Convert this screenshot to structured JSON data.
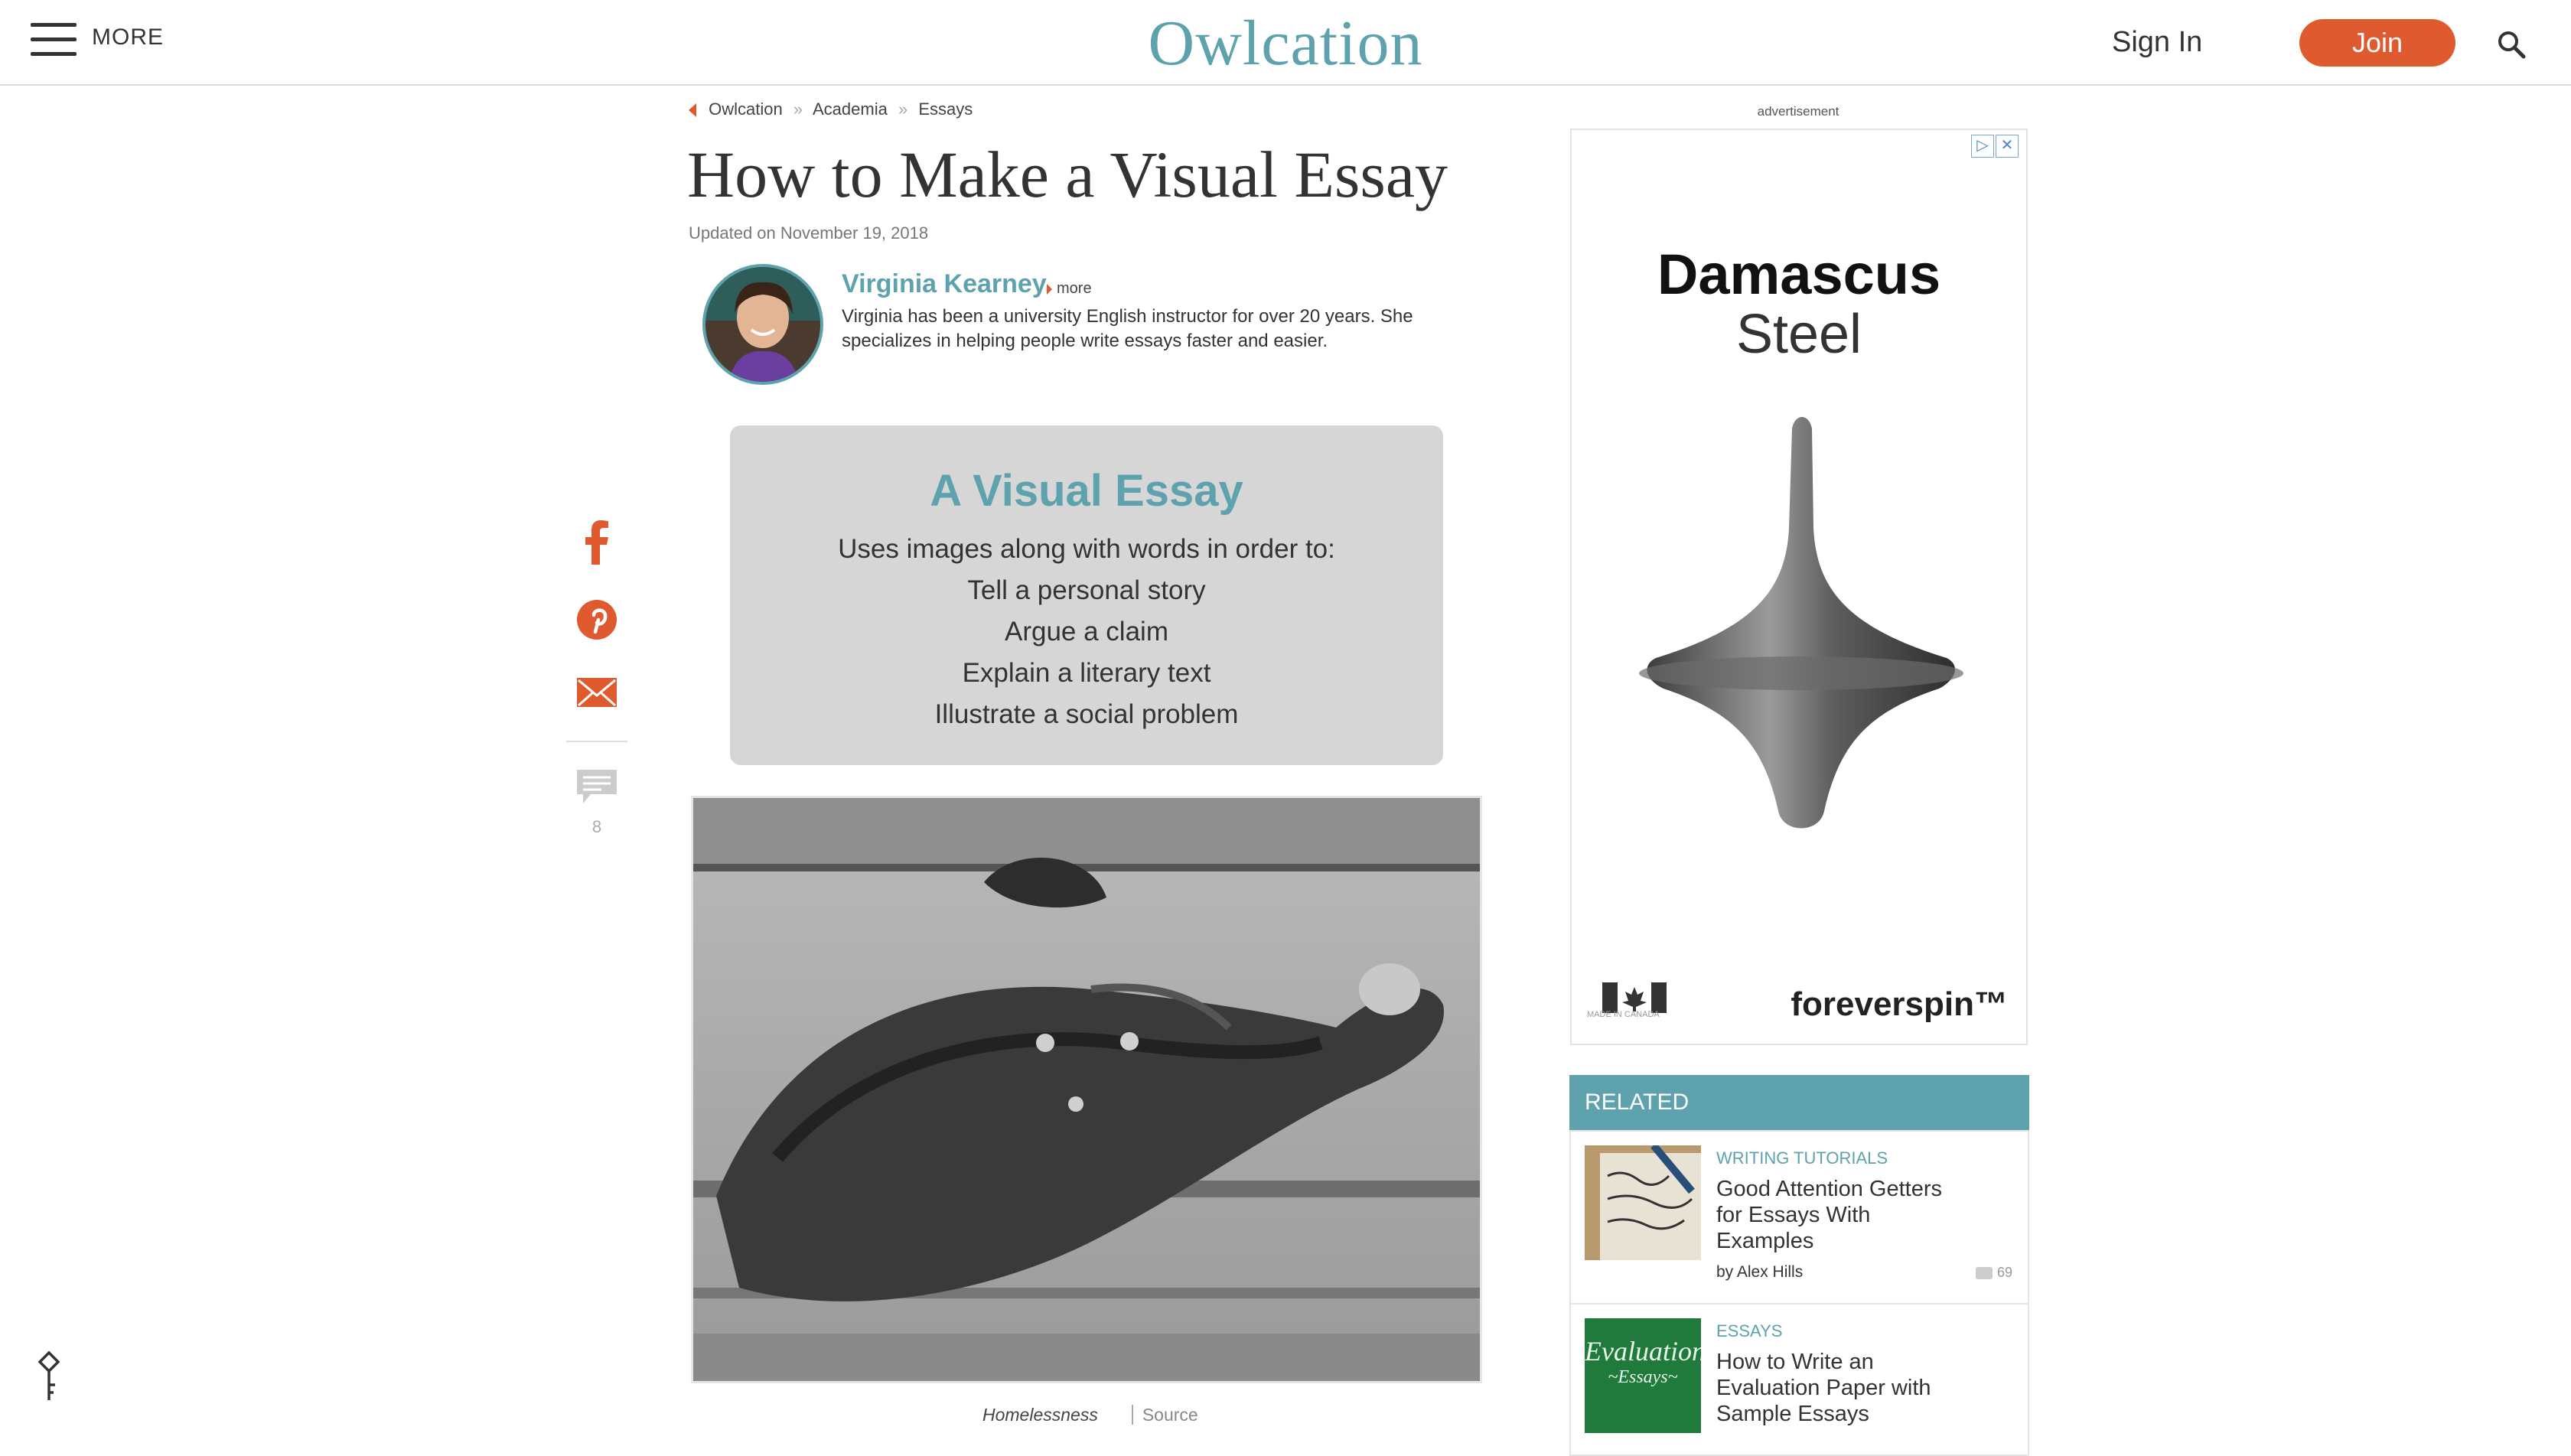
{
  "header": {
    "more_label": "MORE",
    "logo": "Owlcation",
    "sign_in": "Sign In",
    "join": "Join",
    "search_icon": "search-icon"
  },
  "breadcrumb": {
    "items": [
      "Owlcation",
      "Academia",
      "Essays"
    ],
    "separator": "»"
  },
  "article": {
    "title": "How to Make a Visual Essay",
    "updated": "Updated on November 19, 2018",
    "author": {
      "name": "Virginia Kearney",
      "more": "more",
      "bio": "Virginia has been a university English instructor for over 20 years. She specializes in helping people write essays faster and easier."
    },
    "callout": {
      "title": "A Visual Essay",
      "lines": [
        "Uses images along with words in order to:",
        "Tell a personal story",
        "Argue a claim",
        "Explain a literary text",
        "Illustrate a social problem"
      ]
    },
    "photo_caption": "Homelessness",
    "photo_source": "Source"
  },
  "share": {
    "icons": [
      "facebook-icon",
      "pinterest-icon",
      "email-icon",
      "comment-icon"
    ],
    "comment_count": "8"
  },
  "sidebar": {
    "ad_label": "advertisement",
    "ad": {
      "title": "Damascus",
      "subtitle": "Steel",
      "brand": "foreverspin™",
      "made_in": "MADE IN CANADA"
    },
    "related_heading": "RELATED",
    "related": [
      {
        "category": "WRITING TUTORIALS",
        "title": "Good Attention Getters for Essays With Examples",
        "author": "by Alex Hills",
        "comments": "69"
      },
      {
        "category": "ESSAYS",
        "title": "How to Write an Evaluation Paper with Sample Essays",
        "thumb_text_1": "Evaluation",
        "thumb_text_2": "~Essays~"
      }
    ]
  },
  "colors": {
    "brand_teal": "#5da2ad",
    "accent_orange": "#e05a2f",
    "callout_bg": "#d6d6d6"
  }
}
